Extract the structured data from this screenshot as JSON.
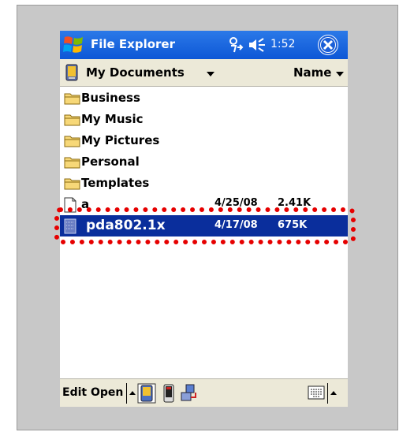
{
  "titlebar": {
    "app_title": "File Explorer",
    "clock": "1:52",
    "icons": [
      "windows-start-icon",
      "connectivity-icon",
      "volume-icon",
      "close-icon"
    ]
  },
  "pathbar": {
    "location": "My Documents",
    "sort_by": "Name"
  },
  "files": [
    {
      "name": "Business",
      "type": "folder",
      "date": "",
      "size": ""
    },
    {
      "name": "My Music",
      "type": "folder",
      "date": "",
      "size": ""
    },
    {
      "name": "My Pictures",
      "type": "folder",
      "date": "",
      "size": ""
    },
    {
      "name": "Personal",
      "type": "folder",
      "date": "",
      "size": ""
    },
    {
      "name": "Templates",
      "type": "folder",
      "date": "",
      "size": ""
    },
    {
      "name": "a",
      "type": "file",
      "date": "4/25/08",
      "size": "2.41K"
    },
    {
      "name": "pda802.1x",
      "type": "file",
      "date": "4/17/08",
      "size": "675K",
      "selected": true
    }
  ],
  "taskbar": {
    "edit_label": "Edit",
    "open_label": "Open"
  },
  "colors": {
    "titlebar": "#0d57d6",
    "selection": "#0a2e9c",
    "highlight": "#e60000",
    "chrome": "#ece9d8"
  }
}
